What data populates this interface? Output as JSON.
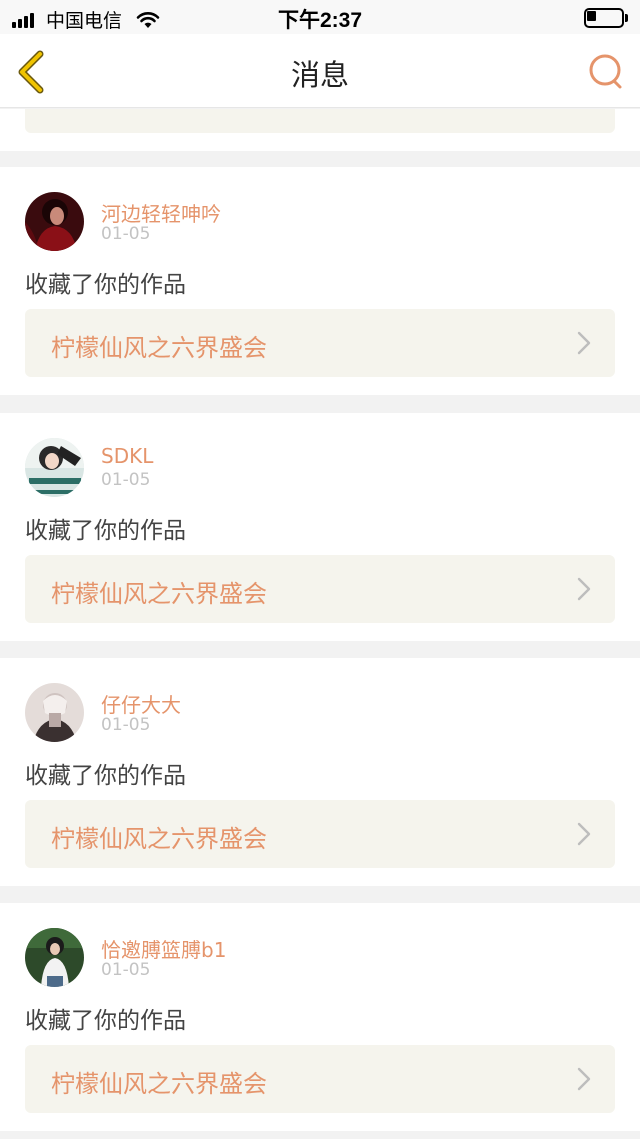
{
  "status": {
    "carrier": "中国电信",
    "time": "下午2:37"
  },
  "header": {
    "title": "消息",
    "back_icon": "chevron-left-icon",
    "search_icon": "search-icon"
  },
  "colors": {
    "accent": "#e5946b",
    "back_icon": "#f0c400",
    "link_bg": "#f5f4ed"
  },
  "messages": [
    {
      "username": "河边轻轻呻吟",
      "date": "01-05",
      "action": "收藏了你的作品",
      "work_title": "柠檬仙风之六界盛会"
    },
    {
      "username": "SDKL",
      "date": "01-05",
      "action": "收藏了你的作品",
      "work_title": "柠檬仙风之六界盛会"
    },
    {
      "username": "仔仔大大",
      "date": "01-05",
      "action": "收藏了你的作品",
      "work_title": "柠檬仙风之六界盛会"
    },
    {
      "username": "恰邀膊篮膊b1",
      "date": "01-05",
      "action": "收藏了你的作品",
      "work_title": "柠檬仙风之六界盛会"
    }
  ]
}
